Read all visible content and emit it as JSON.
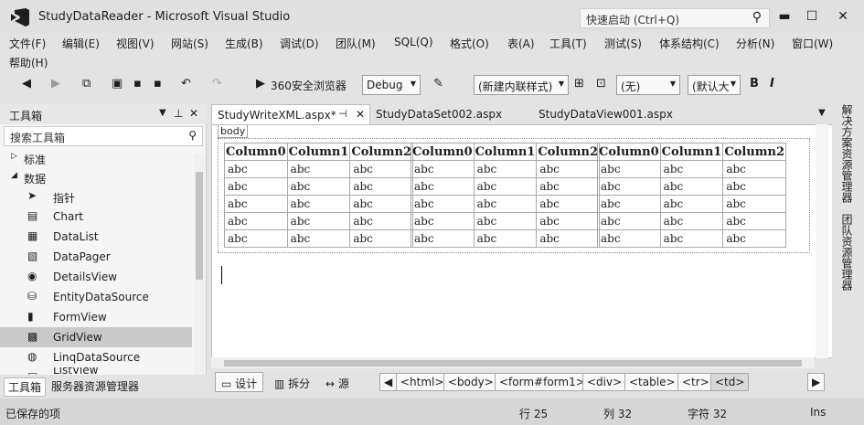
{
  "window": {
    "title": "StudyDataReader - Microsoft Visual Studio",
    "quick_launch_placeholder": "快速启动 (Ctrl+Q)"
  },
  "menu": [
    "文件(F)",
    "编辑(E)",
    "视图(V)",
    "网站(S)",
    "生成(B)",
    "调试(D)",
    "团队(M)",
    "SQL(Q)",
    "格式(O)",
    "表(A)",
    "工具(T)",
    "测试(S)",
    "体系结构(C)",
    "分析(N)",
    "窗口(W)",
    "帮助(H)"
  ],
  "toolbar": {
    "browser": "360安全浏览器",
    "config": "Debug",
    "style": "(新建内联样式)",
    "target": "(无)",
    "font": "(默认大",
    "bold": "B",
    "italic": "I"
  },
  "toolbox": {
    "title": "工具箱",
    "search_placeholder": "搜索工具箱",
    "groups": [
      "标准",
      "数据"
    ],
    "items": [
      "指针",
      "Chart",
      "DataList",
      "DataPager",
      "DetailsView",
      "EntityDataSource",
      "FormView",
      "GridView",
      "LinqDataSource",
      "ListView"
    ],
    "selected": "GridView",
    "tabs": [
      "工具箱",
      "服务器资源管理器"
    ]
  },
  "doc_tabs": [
    "StudyWriteXML.aspx*",
    "StudyDataSet002.aspx",
    "StudyDataView001.aspx"
  ],
  "editor": {
    "body_tag": "body",
    "grid_headers": [
      "Column0",
      "Column1",
      "Column2"
    ],
    "cell_text": "abc",
    "rows": 5,
    "tables": 3
  },
  "viewbar": {
    "design": "设计",
    "split": "拆分",
    "source": "源",
    "crumbs": [
      "<html>",
      "<body>",
      "<form#form1>",
      "<div>",
      "<table>",
      "<tr>",
      "<td>"
    ]
  },
  "rightpanel": [
    "解决方案资源管理器",
    "团队资源管理器"
  ],
  "status": {
    "message": "已保存的项",
    "line": "行 25",
    "col": "列 32",
    "char": "字符 32",
    "mode": "Ins"
  }
}
